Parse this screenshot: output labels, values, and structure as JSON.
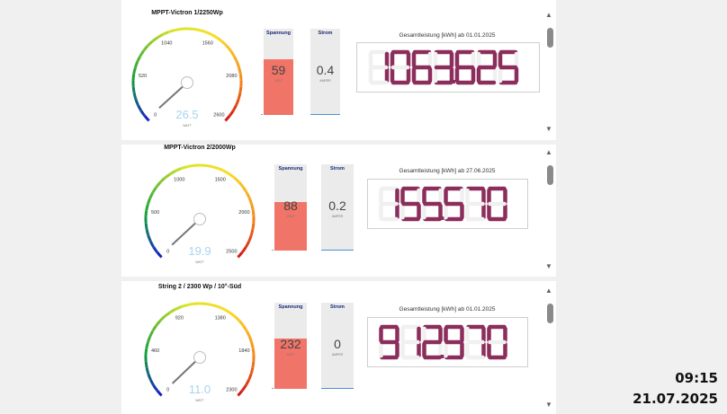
{
  "panels": [
    {
      "title": "MPPT-Victron 1/2250Wp",
      "gauge": {
        "value": 26.5,
        "value_text": "26.5",
        "unit": "WATT",
        "max": 2600,
        "ticks": [
          "0",
          "520",
          "1040",
          "1560",
          "2080",
          "2600"
        ]
      },
      "voltage": {
        "label": "Spannung",
        "value": "59",
        "unit": "VOLT",
        "fraction": 0.65
      },
      "current": {
        "label": "Strom",
        "value": "0.4",
        "unit": "AMPER",
        "fraction": 0.02
      },
      "total": {
        "caption": "Gesamtleistung [kWh] ab 01.01.2025",
        "value": "1063.625"
      }
    },
    {
      "title": "MPPT-Victron 2/2000Wp",
      "gauge": {
        "value": 19.9,
        "value_text": "19.9",
        "unit": "WATT",
        "max": 2500,
        "ticks": [
          "0",
          "500",
          "1000",
          "1500",
          "2000",
          "2500"
        ]
      },
      "voltage": {
        "label": "Spannung",
        "value": "88",
        "unit": "VOLT",
        "fraction": 0.56
      },
      "current": {
        "label": "Strom",
        "value": "0.2",
        "unit": "AMPER",
        "fraction": 0.02
      },
      "total": {
        "caption": "Gesamtleistung [kWh] ab 27.06.2025",
        "value": "155.570"
      }
    },
    {
      "title": "String 2 / 2300 Wp / 10°-Süd",
      "gauge": {
        "value": 11.0,
        "value_text": "11.0",
        "unit": "WATT",
        "max": 2300,
        "ticks": [
          "0",
          "460",
          "920",
          "1380",
          "1840",
          "2300"
        ]
      },
      "voltage": {
        "label": "Spannung",
        "value": "232",
        "unit": "VOLT",
        "fraction": 0.58
      },
      "current": {
        "label": "Strom",
        "value": "0",
        "unit": "AMPER",
        "fraction": 0.0
      },
      "total": {
        "caption": "Gesamtleistung [kWh] ab 01.01.2025",
        "value": "912.970"
      }
    }
  ],
  "clock": {
    "time": "09:15",
    "date": "21.07.2025"
  },
  "colors": {
    "fill": "#f07467",
    "digit": "#8c2e5c",
    "gauge_value": "#a9d4ef",
    "current_line": "#4a90d9"
  }
}
